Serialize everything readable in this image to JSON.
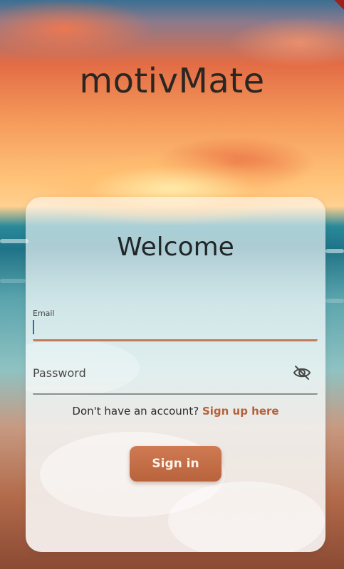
{
  "app": {
    "title": "motivMate"
  },
  "login_card": {
    "heading": "Welcome",
    "email": {
      "label": "Email",
      "value": ""
    },
    "password": {
      "placeholder": "Password",
      "value": "",
      "visibility_icon": "eye-off-icon"
    },
    "signup_prompt": "Don't have an account?",
    "signup_link": "Sign up here",
    "signin_button": "Sign in"
  },
  "colors": {
    "accent": "#b9633d",
    "link": "#b5603a",
    "title_text": "#2b2622",
    "focus_underline": "#c07a58"
  }
}
